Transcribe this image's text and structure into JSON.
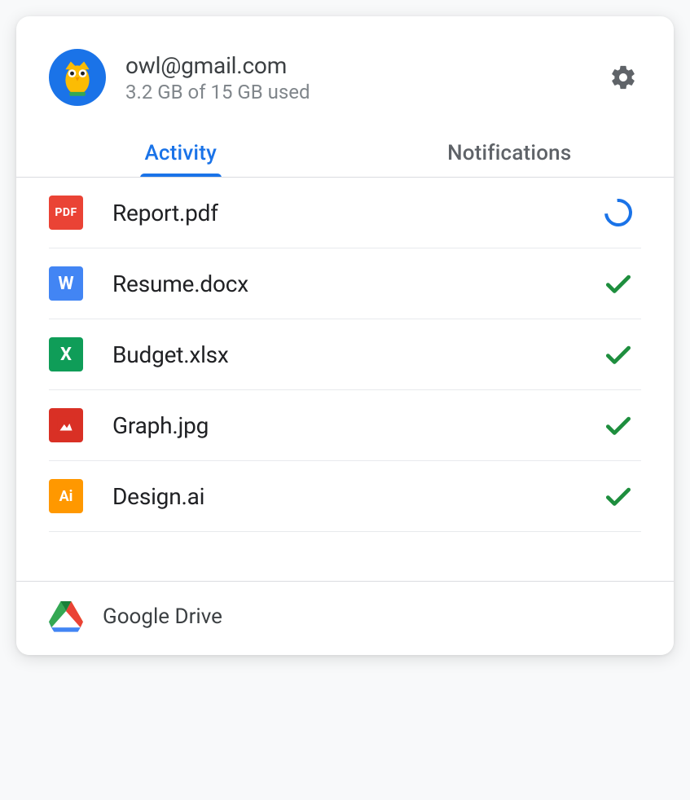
{
  "account": {
    "email": "owl@gmail.com",
    "storage": "3.2 GB of 15 GB used"
  },
  "tabs": [
    {
      "label": "Activity",
      "active": true
    },
    {
      "label": "Notifications",
      "active": false
    }
  ],
  "files": [
    {
      "name": "Report.pdf",
      "type": "pdf",
      "badge": "PDF",
      "status": "uploading"
    },
    {
      "name": "Resume.docx",
      "type": "docx",
      "badge": "W",
      "status": "done"
    },
    {
      "name": "Budget.xlsx",
      "type": "xlsx",
      "badge": "X",
      "status": "done"
    },
    {
      "name": "Graph.jpg",
      "type": "jpg",
      "badge": "",
      "status": "done"
    },
    {
      "name": "Design.ai",
      "type": "ai",
      "badge": "Ai",
      "status": "done"
    }
  ],
  "footer": {
    "label": "Google Drive"
  }
}
